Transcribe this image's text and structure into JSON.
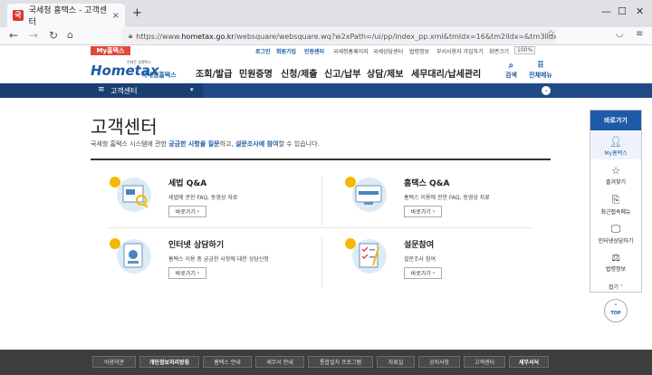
{
  "browser": {
    "tab_title": "국세청 홈택스 - 고객센터",
    "tab_close": "×",
    "new_tab": "+",
    "url_prefix": "https://www.",
    "url_domain": "hometax.go.kr",
    "url_rest": "/websquare/websquare.wq?w2xPath=/ui/pp/index_pp.xml&tmIdx=16&tm2lIdx=&tm3lIdx=",
    "back": "←",
    "forward": "→",
    "reload": "↻",
    "home": "⌂"
  },
  "util": {
    "my_hometax": "My홈택스",
    "links": [
      "로그인",
      "회원가입",
      "인증센터",
      "국세청홈페이지",
      "국세상담센터",
      "법령정보",
      "부서사용자 가입하기",
      "화면크기"
    ],
    "zoom": "100%"
  },
  "logo": {
    "brand": "Hometax",
    "sub": "국세청홈택스",
    "tagline": "언제든 실행택스"
  },
  "menu": [
    "조회/발급",
    "민원증명",
    "신청/제출",
    "신고/납부",
    "상담/제보",
    "세무대리/납세관리"
  ],
  "right_buttons": [
    {
      "icon": "search-icon",
      "label": "검색"
    },
    {
      "icon": "grid-icon",
      "label": "전체메뉴"
    }
  ],
  "subnav": {
    "title": "고객센터"
  },
  "page": {
    "title": "고객센터",
    "desc_pre": "국세청 홈택스 시스템에 관한 ",
    "desc_b1": "궁금한 사항을 질문",
    "desc_mid": "하고, ",
    "desc_b2": "설문조사에 참여",
    "desc_post": "할 수 있습니다."
  },
  "cards": [
    {
      "title": "세법 Q&A",
      "desc": "세법에 관한 FAQ, 동영상 자료",
      "go": "바로가기"
    },
    {
      "title": "홈택스 Q&A",
      "desc": "홈택스 이용에 관한 FAQ, 동영상 자료",
      "go": "바로가기"
    },
    {
      "title": "인터넷 상담하기",
      "desc": "홈택스 이용 중 궁금한 사항에 대한 상담신청",
      "go": "바로가기"
    },
    {
      "title": "설문참여",
      "desc": "설문조사 참여",
      "go": "바로가기"
    }
  ],
  "quick": {
    "header": "바로가기",
    "items": [
      "My홈택스",
      "즐겨찾기",
      "최근접속메뉴",
      "인터넷상담하기",
      "법령정보"
    ],
    "fold": "접기 ˄",
    "top": "TOP"
  },
  "footer": [
    "이용약관",
    "개인정보처리방침",
    "홈택스 안내",
    "세무서 안내",
    "통합설치 프로그램",
    "자료실",
    "공지사항",
    "고객센터",
    "세무서식"
  ],
  "colors": {
    "brand_blue": "#1d5ba8",
    "nav_dark": "#214b86",
    "accent_red": "#e2483f",
    "footer": "#3d3d3d",
    "card_yellow": "#f5b800"
  }
}
